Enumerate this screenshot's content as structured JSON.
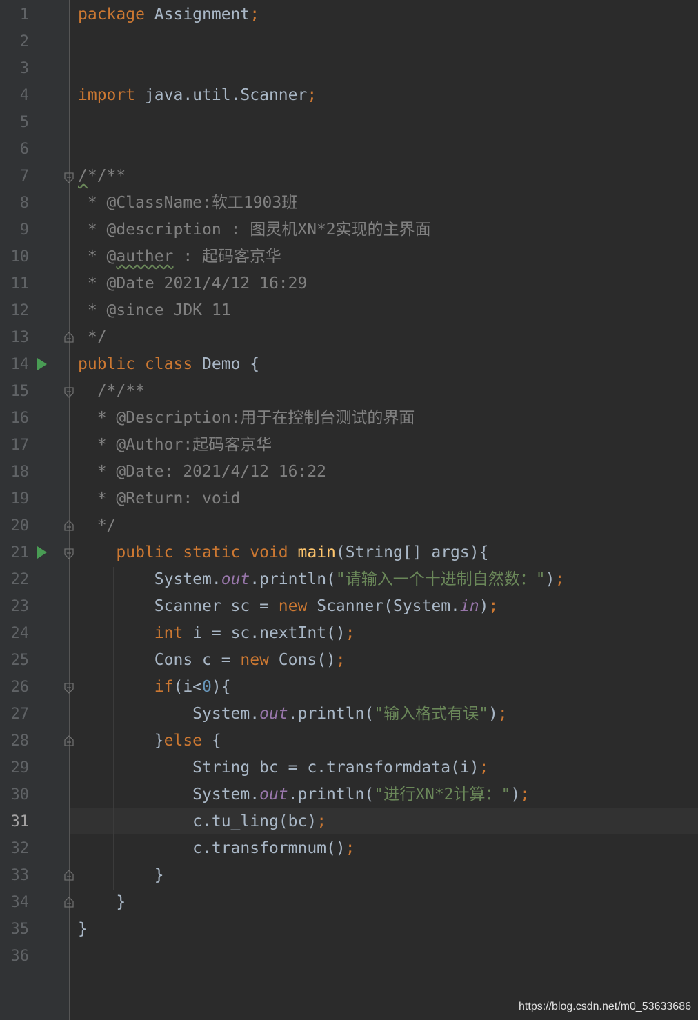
{
  "editor": {
    "current_line": 31,
    "line_numbers": [
      "1",
      "2",
      "3",
      "4",
      "5",
      "6",
      "7",
      "8",
      "9",
      "10",
      "11",
      "12",
      "13",
      "14",
      "15",
      "16",
      "17",
      "18",
      "19",
      "20",
      "21",
      "22",
      "23",
      "24",
      "25",
      "26",
      "27",
      "28",
      "29",
      "30",
      "31",
      "32",
      "33",
      "34",
      "35",
      "36"
    ],
    "tokens": {
      "l1_kw": "package",
      "l1_rest": " Assignment",
      "l1_semi": ";",
      "l4_kw": "import",
      "l4_rest": " java.util.Scanner",
      "l4_semi": ";",
      "l7_a": "/",
      "l7_b": "*/**",
      "l8": " * @ClassName:软工1903班",
      "l9": " * @description : 图灵机XN*2实现的主界面",
      "l10_a": " * @",
      "l10_b": "auther",
      "l10_c": " : 起码客京华",
      "l11": " * @Date 2021/4/12 16:29",
      "l12": " * @since JDK 11",
      "l13": " */",
      "l14_kw1": "public",
      "l14_kw2": " class",
      "l14_rest": " Demo {",
      "l15": "  /*/**",
      "l16": "  * @Description:用于在控制台测试的界面",
      "l17": "  * @Author:起码客京华",
      "l18": "  * @Date: 2021/4/12 16:22",
      "l19": "  * @Return: void",
      "l20": "  */",
      "l21_kw": "    public static void ",
      "l21_fn": "main",
      "l21_rest": "(String[] args){",
      "l22_a": "        System.",
      "l22_field": "out",
      "l22_b": ".println(",
      "l22_str": "\"请输入一个十进制自然数：\"",
      "l22_c": ")",
      "l22_semi": ";",
      "l23_a": "        Scanner sc = ",
      "l23_kw": "new",
      "l23_b": " Scanner(System.",
      "l23_field": "in",
      "l23_c": ")",
      "l23_semi": ";",
      "l24_kw": "        int",
      "l24_a": " i = sc.nextInt()",
      "l24_semi": ";",
      "l25_a": "        Cons c = ",
      "l25_kw": "new",
      "l25_b": " Cons()",
      "l25_semi": ";",
      "l26_kw": "        if",
      "l26_a": "(i<",
      "l26_num": "0",
      "l26_b": "){",
      "l27_a": "            System.",
      "l27_field": "out",
      "l27_b": ".println(",
      "l27_str": "\"输入格式有误\"",
      "l27_c": ")",
      "l27_semi": ";",
      "l28_a": "        }",
      "l28_kw": "else",
      "l28_b": " {",
      "l29_a": "            String bc = c.transformdata(i)",
      "l29_semi": ";",
      "l30_a": "            System.",
      "l30_field": "out",
      "l30_b": ".println(",
      "l30_str": "\"进行XN*2计算：\"",
      "l30_c": ")",
      "l30_semi": ";",
      "l31_a": "            c.tu_ling(bc)",
      "l31_semi": ";",
      "l32_a": "            c.transformnum()",
      "l32_semi": ";",
      "l33": "        }",
      "l34": "    }",
      "l35": "}"
    }
  },
  "watermark": "https://blog.csdn.net/m0_53633686",
  "colors": {
    "background": "#2b2b2b",
    "gutter": "#313335",
    "keyword": "#cc7832",
    "function": "#ffc66d",
    "string": "#6a8759",
    "number": "#6897bb",
    "field": "#9876aa",
    "comment": "#808080",
    "text": "#a9b7c6",
    "run_icon": "#499c54"
  },
  "icons": [
    "run-icon",
    "fold-icon"
  ]
}
